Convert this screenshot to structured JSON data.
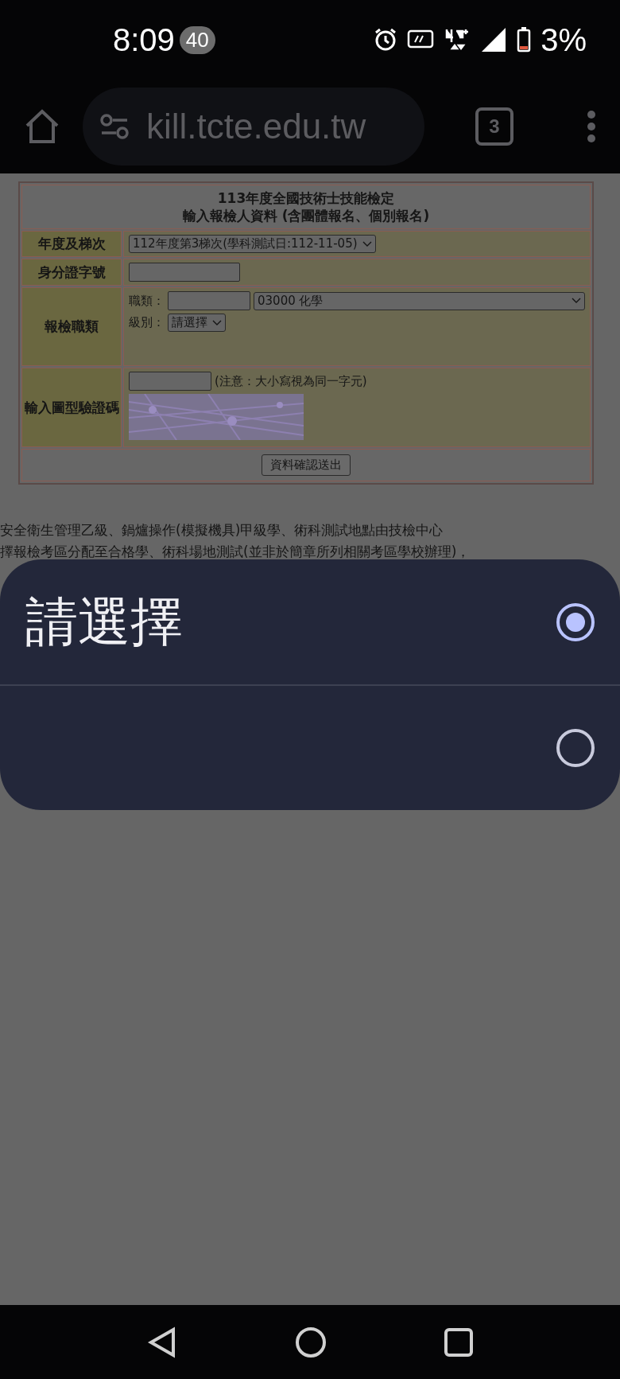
{
  "status_bar": {
    "time": "8:09",
    "badge": "40",
    "battery": "3%"
  },
  "browser": {
    "url": "kill.tcte.edu.tw",
    "tab_count": "3"
  },
  "form": {
    "title_lines": [
      "113年度全國技術士技能檢定",
      "輸入報檢人資料 (含團體報名、個別報名)"
    ],
    "rows": [
      {
        "kind": "select",
        "label": "年度及梯次",
        "value": "112年度第3梯次(學科測試日:112-11-05)"
      },
      {
        "kind": "input",
        "label": "身分證字號"
      },
      {
        "kind": "trade",
        "label": "報檢職類",
        "trade_label": "職類：",
        "trade_select": "03000 化學",
        "level_label": "級別：",
        "level_select": "請選擇"
      },
      {
        "kind": "captcha",
        "label": "輸入圖型驗證碼",
        "note": "(注意：大小寫視為同一字元)"
      }
    ],
    "submit": "資料確認送出"
  },
  "notes": [
    "安全衛生管理乙級、鍋爐操作(模擬機具)甲級學、術科測試地點由技檢中心",
    "擇報檢考區分配至合格學、術科場地測試(並非於簡章所列相關考區學校辦理)，"
  ],
  "picker": {
    "options": [
      {
        "label": "請選擇",
        "selected": true
      },
      {
        "selected": false
      }
    ]
  }
}
